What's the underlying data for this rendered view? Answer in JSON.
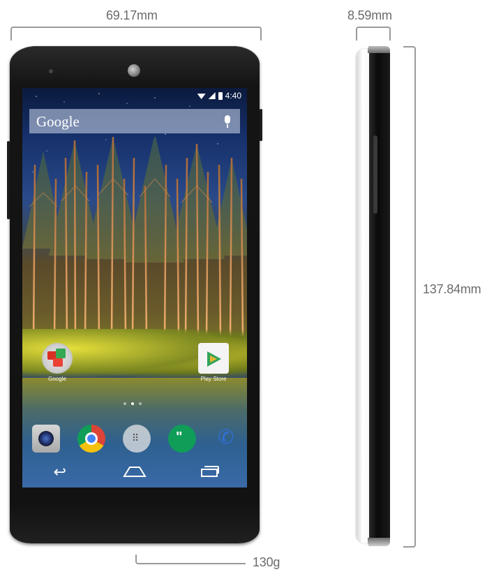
{
  "dimensions": {
    "width_label": "69.17mm",
    "depth_label": "8.59mm",
    "height_label": "137.84mm",
    "weight_label": "130g"
  },
  "phone_screen": {
    "status_time": "4:40",
    "search_label": "Google",
    "home_apps": [
      {
        "label": "Google",
        "icon": "google-apps-folder-icon"
      },
      {
        "label": "Play Store",
        "icon": "play-store-icon"
      }
    ],
    "dock_icons": [
      "camera-icon",
      "chrome-icon",
      "app-drawer-icon",
      "hangouts-icon",
      "phone-icon"
    ],
    "nav_icons": [
      "back-icon",
      "home-icon",
      "recents-icon"
    ],
    "page_indicator": {
      "count": 3,
      "active": 2
    }
  },
  "colors": {
    "phone_body": "#141414",
    "side_white": "#f3f3f3",
    "dimension_text": "#6b6b6b",
    "bracket_line": "#9a9a9a"
  }
}
